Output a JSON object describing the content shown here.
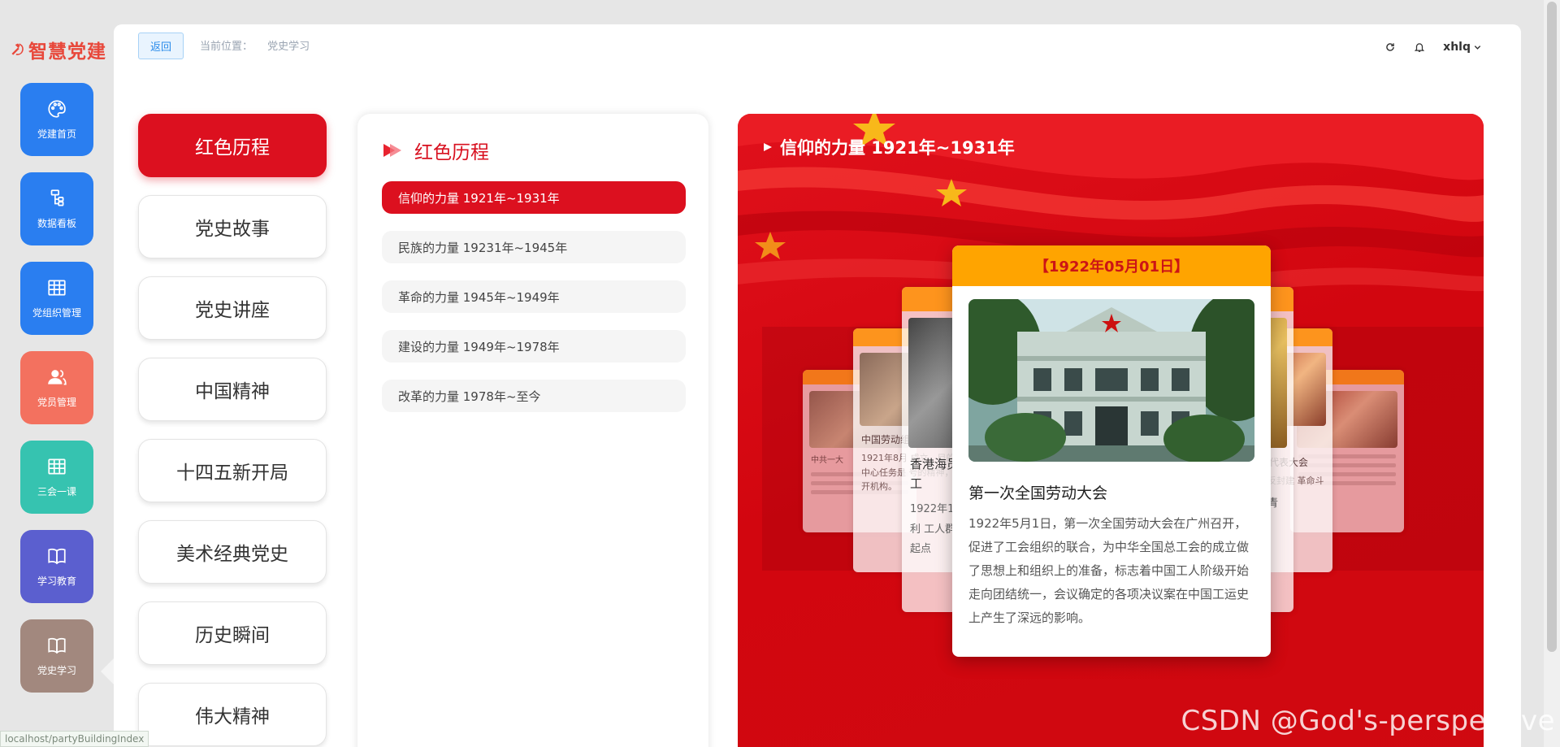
{
  "app": {
    "logo_text": "智慧党建",
    "brand_color": "#e8483b"
  },
  "nav": [
    {
      "label": "党建首页",
      "icon": "palette-icon",
      "color": "#2a7ef0"
    },
    {
      "label": "数据看板",
      "icon": "flow-icon",
      "color": "#2a7ef0"
    },
    {
      "label": "党组织管理",
      "icon": "table-icon",
      "color": "#2a7ef0"
    },
    {
      "label": "党员管理",
      "icon": "users-icon",
      "color": "#f3715f"
    },
    {
      "label": "三会一课",
      "icon": "grid-icon",
      "color": "#36c3b0"
    },
    {
      "label": "学习教育",
      "icon": "book-icon",
      "color": "#5b5fcf"
    },
    {
      "label": "党史学习",
      "icon": "book-icon",
      "color": "#a2887e"
    }
  ],
  "topbar": {
    "back_label": "返回",
    "crumb_label": "当前位置：",
    "crumb_value": "党史学习",
    "user": "xhlq"
  },
  "categories": [
    {
      "label": "红色历程",
      "active": true
    },
    {
      "label": "党史故事"
    },
    {
      "label": "党史讲座"
    },
    {
      "label": "中国精神"
    },
    {
      "label": "十四五新开局"
    },
    {
      "label": "美术经典党史"
    },
    {
      "label": "历史瞬间"
    },
    {
      "label": "伟大精神"
    }
  ],
  "periods": {
    "title": "红色历程",
    "items": [
      {
        "label": "信仰的力量 1921年~1931年",
        "active": true
      },
      {
        "label": "民族的力量 19231年~1945年"
      },
      {
        "label": "革命的力量 1945年~1949年"
      },
      {
        "label": "建设的力量 1949年~1978年"
      },
      {
        "label": "改革的力量 1978年~至今"
      }
    ]
  },
  "hero": {
    "title": "信仰的力量 1921年~1931年",
    "side_left_far": {
      "text": "中共一大"
    },
    "side_left_mid": {
      "text": "中国劳动组合书记部",
      "body": "1921年8月 成立，目的是 中心任务是 号的精神， 公开机构。"
    },
    "side_left_near": {
      "text": "香港海员大罢工",
      "body": "1922年1 工的胜利 工人群众 潮的起点"
    },
    "side_right_near": {
      "text": "第一次全国",
      "body": "的青年团 中国青年"
    },
    "side_right_mid": {
      "text": "中国代表大会",
      "body": "反帝反封建 革命斗争指"
    },
    "main_card": {
      "date": "【1922年05月01日】",
      "title": "第一次全国劳动大会",
      "desc": "1922年5月1日，第一次全国劳动大会在广州召开，促进了工会组织的联合，为中华全国总工会的成立做了思想上和组织上的准备，标志着中国工人阶级开始走向团结统一，会议确定的各项决议案在中国工运史上产生了深远的影响。"
    }
  },
  "watermark": "CSDN @God's-perspective",
  "status_url": "localhost/partyBuildingIndex",
  "colors": {
    "party_red": "#dc101f",
    "date_bar": "#ffa400"
  }
}
